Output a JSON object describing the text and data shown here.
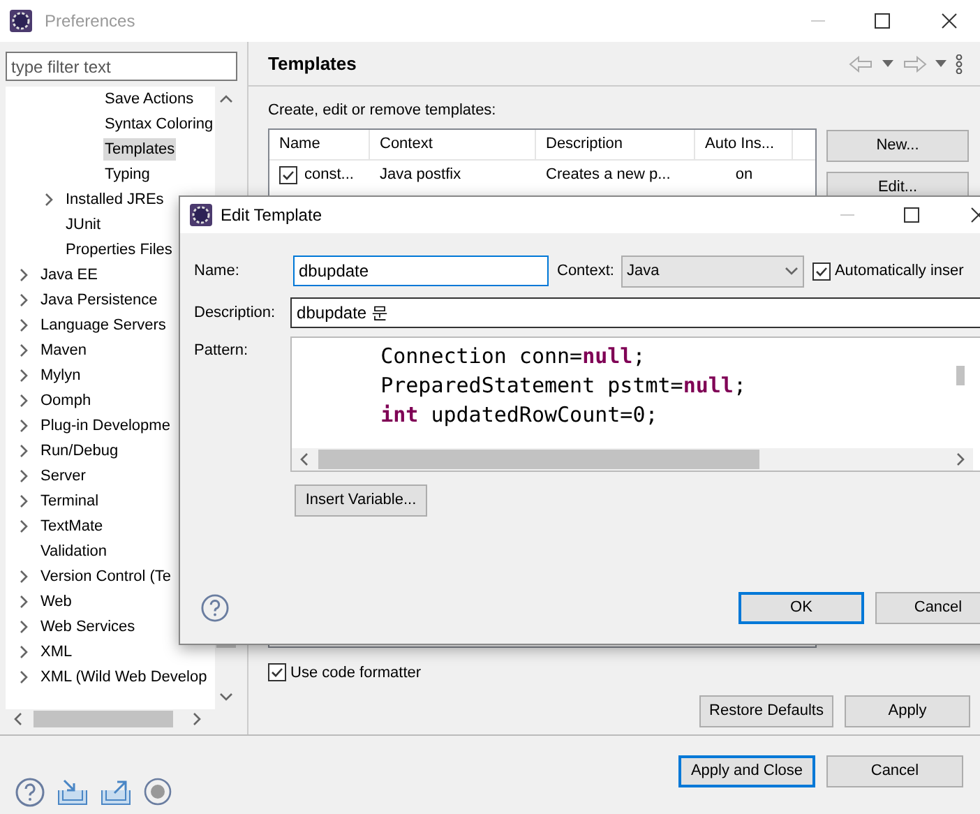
{
  "window": {
    "title": "Preferences"
  },
  "filter": {
    "placeholder": "type filter text"
  },
  "tree": [
    {
      "children": [
        {
          "children": [
            {
              "label": "Save Actions",
              "selected": false,
              "expandable": false
            },
            {
              "label": "Syntax Coloring",
              "selected": false,
              "expandable": false
            },
            {
              "label": "Templates",
              "selected": true,
              "expandable": false
            },
            {
              "label": "Typing",
              "selected": false,
              "expandable": false
            }
          ]
        },
        {
          "label": "Installed JREs",
          "selected": false,
          "expandable": true
        },
        {
          "label": "JUnit",
          "selected": false,
          "expandable": false
        },
        {
          "label": "Properties Files",
          "selected": false,
          "expandable": false
        }
      ]
    },
    {
      "label": "Java EE",
      "selected": false,
      "expandable": true
    },
    {
      "label": "Java Persistence",
      "selected": false,
      "expandable": true
    },
    {
      "label": "Language Servers",
      "selected": false,
      "expandable": true
    },
    {
      "label": "Maven",
      "selected": false,
      "expandable": true
    },
    {
      "label": "Mylyn",
      "selected": false,
      "expandable": true
    },
    {
      "label": "Oomph",
      "selected": false,
      "expandable": true
    },
    {
      "label": "Plug-in Developme",
      "selected": false,
      "expandable": true
    },
    {
      "label": "Run/Debug",
      "selected": false,
      "expandable": true
    },
    {
      "label": "Server",
      "selected": false,
      "expandable": true
    },
    {
      "label": "Terminal",
      "selected": false,
      "expandable": true
    },
    {
      "label": "TextMate",
      "selected": false,
      "expandable": true
    },
    {
      "label": "Validation",
      "selected": false,
      "expandable": false
    },
    {
      "label": "Version Control (Te",
      "selected": false,
      "expandable": true
    },
    {
      "label": "Web",
      "selected": false,
      "expandable": true
    },
    {
      "label": "Web Services",
      "selected": false,
      "expandable": true
    },
    {
      "label": "XML",
      "selected": false,
      "expandable": true
    },
    {
      "label": "XML (Wild Web Develop",
      "selected": false,
      "expandable": true
    }
  ],
  "page": {
    "title": "Templates",
    "intro": "Create, edit or remove templates:",
    "table": {
      "columns": [
        "Name",
        "Context",
        "Description",
        "Auto Ins..."
      ],
      "rows": [
        {
          "checked": true,
          "cells": [
            "const...",
            "Java postfix",
            "Creates a new p...",
            "on"
          ]
        }
      ]
    },
    "side_buttons": [
      "New...",
      "Edit..."
    ],
    "use_code_formatter": {
      "label": "Use code formatter",
      "checked": true
    },
    "buttons": [
      "Restore Defaults",
      "Apply"
    ]
  },
  "footer_buttons": [
    {
      "label": "Apply and Close",
      "default": true
    },
    {
      "label": "Cancel",
      "default": false
    }
  ],
  "dialog": {
    "title": "Edit Template",
    "name": {
      "label": "Name:",
      "value": "dbupdate"
    },
    "context": {
      "label": "Context:",
      "value": "Java"
    },
    "auto_insert": {
      "label": "Automatically inser",
      "checked": true
    },
    "description": {
      "label": "Description:",
      "value": "dbupdate 문"
    },
    "pattern": {
      "label": "Pattern:",
      "lines": [
        [
          {
            "kind": "plain",
            "text": "Connection conn="
          },
          {
            "kind": "keyword",
            "text": "null"
          },
          {
            "kind": "plain",
            "text": ";"
          }
        ],
        [
          {
            "kind": "plain",
            "text": "PreparedStatement pstmt="
          },
          {
            "kind": "keyword",
            "text": "null"
          },
          {
            "kind": "plain",
            "text": ";"
          }
        ],
        [
          {
            "kind": "keyword",
            "text": "int"
          },
          {
            "kind": "plain",
            "text": " updatedRowCount=0;"
          }
        ]
      ]
    },
    "insert_button": "Insert Variable...",
    "buttons": [
      {
        "label": "OK",
        "default": true
      },
      {
        "label": "Cancel",
        "default": false
      }
    ]
  }
}
